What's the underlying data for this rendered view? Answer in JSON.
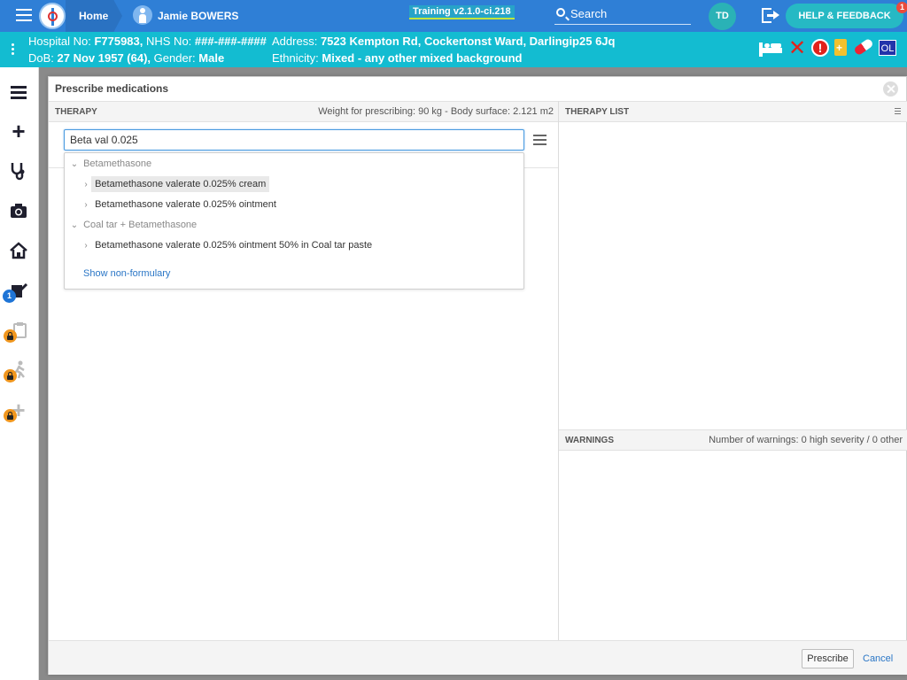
{
  "topbar": {
    "home_label": "Home",
    "patient_name": "Jamie BOWERS",
    "version": "Training v2.1.0-ci.218",
    "search_label": "Search",
    "user_initials": "TD",
    "help_label": "HELP & FEEDBACK",
    "help_badge_count": "1"
  },
  "banner": {
    "hospital_label": "Hospital No:",
    "hospital_no": "F775983,",
    "nhs_label": "NHS No:",
    "nhs_no": "###-###-####",
    "address_label": "Address:",
    "address": "7523 Kempton Rd, Cockertonst Ward, Darlingip25 6Jq",
    "dob_label": "DoB:",
    "dob": "27 Nov 1957 (64),",
    "gender_label": "Gender:",
    "gender": "Male",
    "ethnicity_label": "Ethnicity:",
    "ethnicity": "Mixed - any other mixed background",
    "icons": [
      "bed-icon",
      "x-icon",
      "alert-icon",
      "clipboard-icon",
      "pill-icon",
      "ol-icon"
    ],
    "ol_label": "OL"
  },
  "leftnav": {
    "items": [
      "list-icon",
      "plus-icon",
      "stethoscope-icon",
      "camera-icon",
      "home-icon",
      "edit-icon",
      "clipboard-icon",
      "walking-icon",
      "add-icon"
    ],
    "edit_badge": "1"
  },
  "modal": {
    "title": "Prescribe medications",
    "therapy_header": "THERAPY",
    "weight_info": "Weight for prescribing: 90 kg - Body surface: 2.121 m2",
    "therapy_list_header": "THERAPY LIST",
    "search_value": "Beta val 0.025",
    "results": [
      {
        "group": "Betamethasone",
        "items": [
          "Betamethasone valerate 0.025% cream",
          "Betamethasone valerate 0.025% ointment"
        ]
      },
      {
        "group": "Coal tar + Betamethasone",
        "items": [
          "Betamethasone valerate 0.025% ointment 50% in Coal tar paste"
        ]
      }
    ],
    "show_non_formulary": "Show non-formulary",
    "warnings_header": "WARNINGS",
    "warnings_summary": "Number of warnings: 0 high severity / 0 other",
    "prescribe_label": "Prescribe",
    "cancel_label": "Cancel"
  },
  "colors": {
    "topbar": "#2f7fd6",
    "banner": "#13bcd1",
    "link": "#2a76c6"
  }
}
